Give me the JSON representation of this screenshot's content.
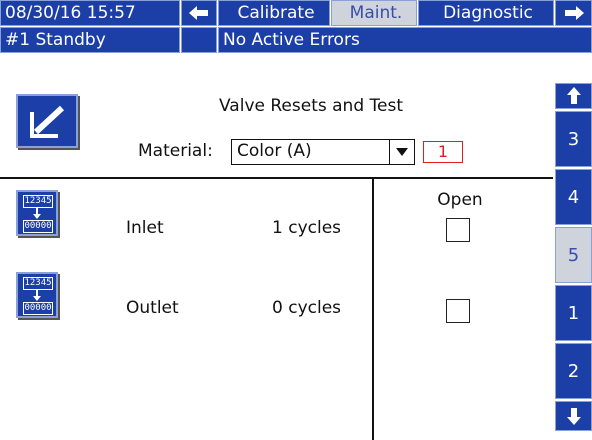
{
  "header": {
    "datetime": "08/30/16 15:57",
    "tabs": [
      "Calibrate",
      "Maint.",
      "Diagnostic"
    ],
    "active_tab": "Maint.",
    "status_left": "#1 Standby",
    "status_right": "No Active Errors"
  },
  "panel": {
    "title": "Valve Resets and Test",
    "material_label": "Material:",
    "material_value": "Color (A)",
    "material_number": "1"
  },
  "table": {
    "open_header": "Open",
    "rows": [
      {
        "name": "Inlet",
        "cycles": "1 cycles",
        "open": false
      },
      {
        "name": "Outlet",
        "cycles": "0 cycles",
        "open": false
      }
    ],
    "reset_icon_top": "12345",
    "reset_icon_bottom": "00000"
  },
  "side_tabs": [
    "3",
    "4",
    "5",
    "1",
    "2"
  ],
  "active_side_tab": "5",
  "colors": {
    "primary": "#1b3fa6",
    "accent_red": "#e02020",
    "active_tab_bg": "#cfd3dc"
  }
}
